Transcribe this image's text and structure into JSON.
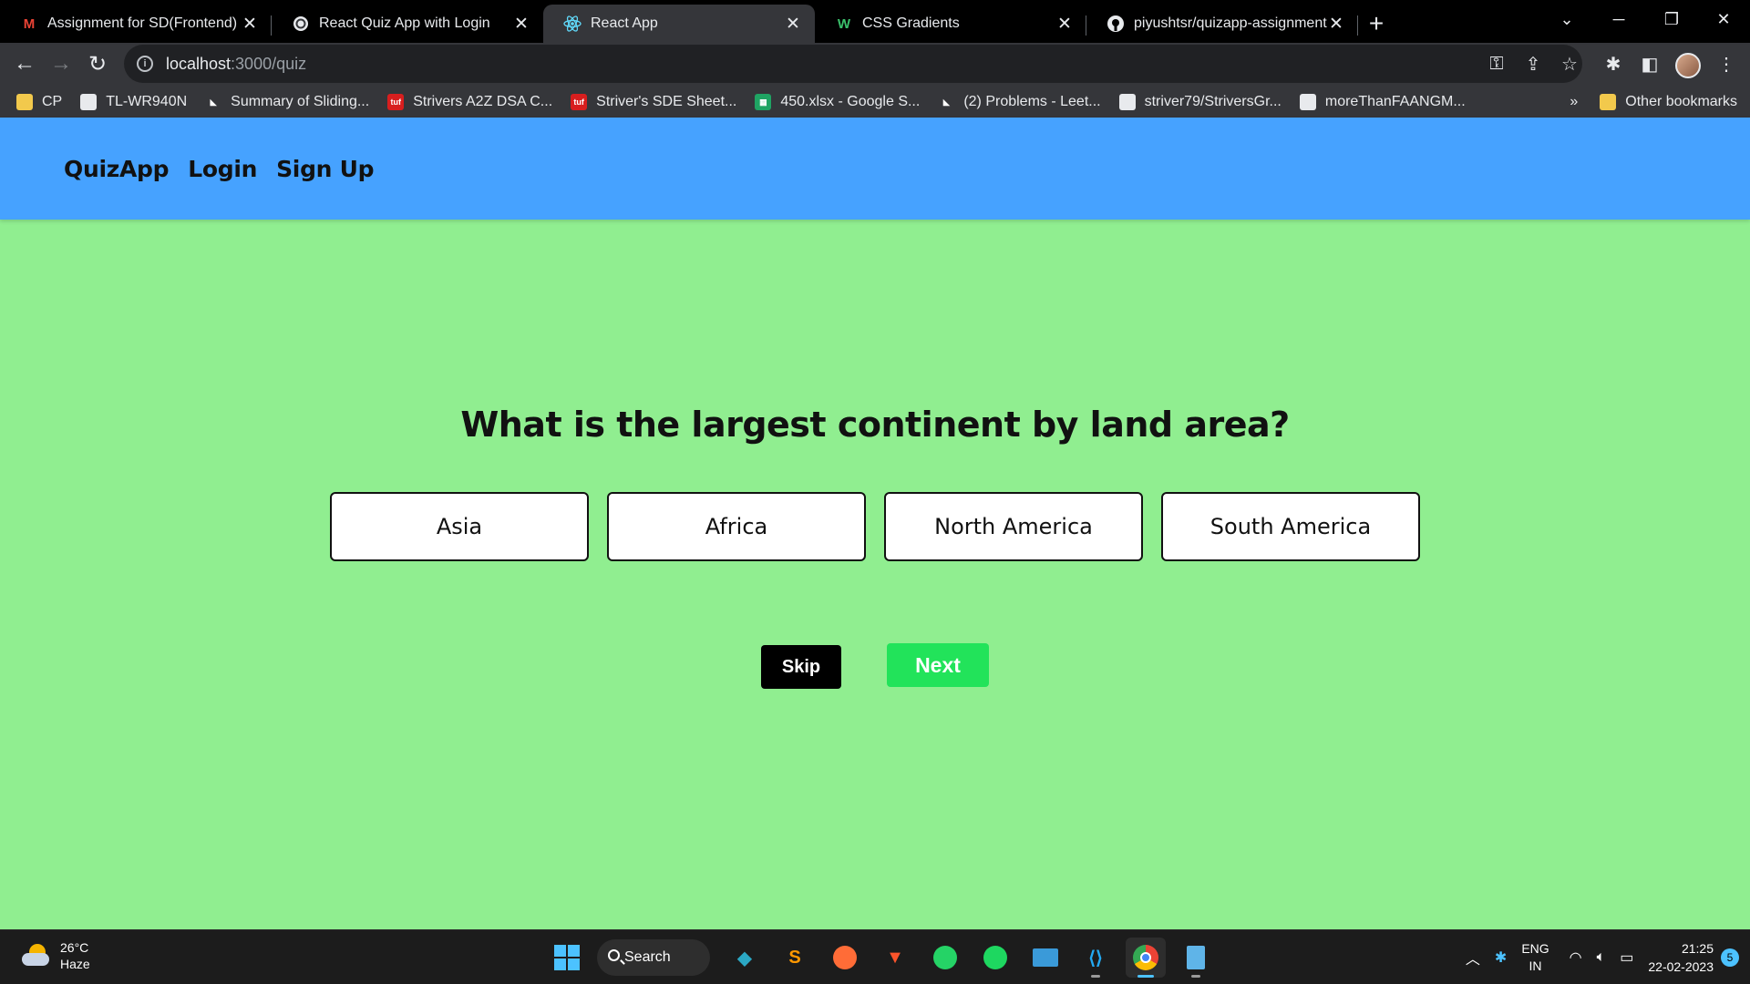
{
  "browser": {
    "tabs": [
      {
        "title": "Assignment for SD(Frontend) Inte",
        "favicon": "gmail-icon",
        "active": false
      },
      {
        "title": "React Quiz App with Login",
        "favicon": "chatgpt-icon",
        "active": false
      },
      {
        "title": "React App",
        "favicon": "react-icon",
        "active": true
      },
      {
        "title": "CSS Gradients",
        "favicon": "w-icon",
        "active": false
      },
      {
        "title": "piyushtsr/quizapp-assignment",
        "favicon": "github-icon",
        "active": false
      }
    ],
    "address": {
      "host": "localhost",
      "path": ":3000/quiz"
    },
    "bookmarks": [
      {
        "label": "CP",
        "icon": "folder-icon"
      },
      {
        "label": "TL-WR940N",
        "icon": "globe-icon"
      },
      {
        "label": "Summary of Sliding...",
        "icon": "leetcode-icon"
      },
      {
        "label": "Strivers A2Z DSA C...",
        "icon": "tuf-icon"
      },
      {
        "label": "Striver's SDE Sheet...",
        "icon": "tuf-icon"
      },
      {
        "label": "450.xlsx - Google S...",
        "icon": "sheets-icon"
      },
      {
        "label": "(2) Problems - Leet...",
        "icon": "leetcode-icon"
      },
      {
        "label": "striver79/StriversGr...",
        "icon": "github-icon"
      },
      {
        "label": "moreThanFAANGM...",
        "icon": "globe-icon"
      }
    ],
    "other_bookmarks": "Other bookmarks"
  },
  "app": {
    "nav": {
      "brand": "QuizApp",
      "login": "Login",
      "signup": "Sign Up"
    },
    "question": "What is the largest continent by land area?",
    "options": [
      "Asia",
      "Africa",
      "North America",
      "South America"
    ],
    "skip_label": "Skip",
    "next_label": "Next",
    "colors": {
      "page_bg": "#90ee90",
      "nav_bg": "#46a2ff",
      "next_bg": "#22e35a",
      "skip_bg": "#000000"
    }
  },
  "taskbar": {
    "weather": {
      "temp": "26°C",
      "condition": "Haze"
    },
    "search_label": "Search",
    "lang": {
      "line1": "ENG",
      "line2": "IN"
    },
    "time": "21:25",
    "date": "22-02-2023",
    "notifications": "5"
  }
}
